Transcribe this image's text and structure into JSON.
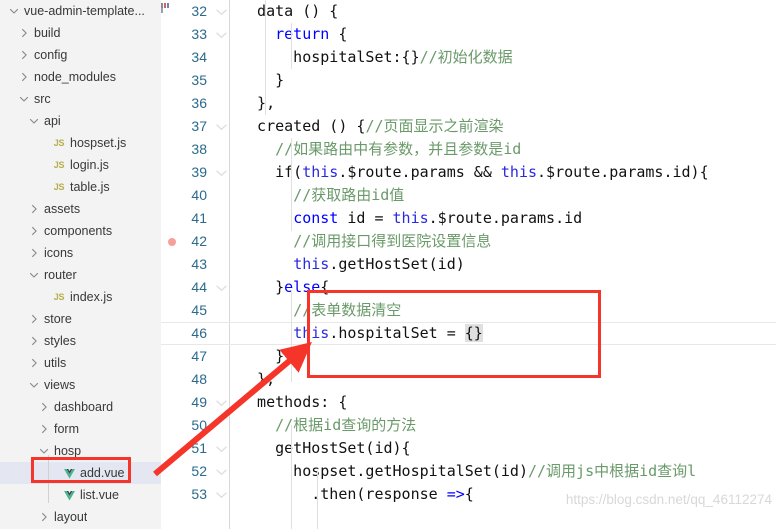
{
  "explorer": {
    "items": [
      {
        "label": "vue-admin-template...",
        "depth": 0,
        "kind": "folder",
        "state": "expanded",
        "icon": "chevron-down-icon"
      },
      {
        "label": "build",
        "depth": 1,
        "kind": "folder",
        "state": "collapsed",
        "icon": "chevron-right-icon"
      },
      {
        "label": "config",
        "depth": 1,
        "kind": "folder",
        "state": "collapsed",
        "icon": "chevron-right-icon"
      },
      {
        "label": "node_modules",
        "depth": 1,
        "kind": "folder",
        "state": "collapsed",
        "icon": "chevron-right-icon"
      },
      {
        "label": "src",
        "depth": 1,
        "kind": "folder",
        "state": "expanded",
        "icon": "chevron-down-icon"
      },
      {
        "label": "api",
        "depth": 2,
        "kind": "folder",
        "state": "expanded",
        "icon": "chevron-down-icon"
      },
      {
        "label": "hospset.js",
        "depth": 3,
        "kind": "file",
        "icon": "js-file-icon"
      },
      {
        "label": "login.js",
        "depth": 3,
        "kind": "file",
        "icon": "js-file-icon"
      },
      {
        "label": "table.js",
        "depth": 3,
        "kind": "file",
        "icon": "js-file-icon"
      },
      {
        "label": "assets",
        "depth": 2,
        "kind": "folder",
        "state": "collapsed",
        "icon": "chevron-right-icon"
      },
      {
        "label": "components",
        "depth": 2,
        "kind": "folder",
        "state": "collapsed",
        "icon": "chevron-right-icon"
      },
      {
        "label": "icons",
        "depth": 2,
        "kind": "folder",
        "state": "collapsed",
        "icon": "chevron-right-icon"
      },
      {
        "label": "router",
        "depth": 2,
        "kind": "folder",
        "state": "expanded",
        "icon": "chevron-down-icon"
      },
      {
        "label": "index.js",
        "depth": 3,
        "kind": "file",
        "icon": "js-file-icon"
      },
      {
        "label": "store",
        "depth": 2,
        "kind": "folder",
        "state": "collapsed",
        "icon": "chevron-right-icon"
      },
      {
        "label": "styles",
        "depth": 2,
        "kind": "folder",
        "state": "collapsed",
        "icon": "chevron-right-icon"
      },
      {
        "label": "utils",
        "depth": 2,
        "kind": "folder",
        "state": "collapsed",
        "icon": "chevron-right-icon"
      },
      {
        "label": "views",
        "depth": 2,
        "kind": "folder",
        "state": "expanded",
        "icon": "chevron-down-icon"
      },
      {
        "label": "dashboard",
        "depth": 3,
        "kind": "folder",
        "state": "collapsed",
        "icon": "chevron-right-icon"
      },
      {
        "label": "form",
        "depth": 3,
        "kind": "folder",
        "state": "collapsed",
        "icon": "chevron-right-icon"
      },
      {
        "label": "hosp",
        "depth": 3,
        "kind": "folder",
        "state": "expanded",
        "icon": "chevron-down-icon"
      },
      {
        "label": "add.vue",
        "depth": 4,
        "kind": "file",
        "icon": "vue-file-icon",
        "selected": true
      },
      {
        "label": "list.vue",
        "depth": 4,
        "kind": "file",
        "icon": "vue-file-icon"
      },
      {
        "label": "layout",
        "depth": 3,
        "kind": "folder",
        "state": "collapsed",
        "icon": "chevron-right-icon"
      }
    ]
  },
  "editor": {
    "first_line_number": 32,
    "active_line_number": 46,
    "breakpoint_line_number": 42,
    "fold_lines": [
      32,
      33,
      37,
      39,
      44,
      49,
      51,
      52,
      53
    ],
    "lines": [
      {
        "n": 32,
        "tokens": [
          {
            "t": "plain",
            "s": "  data () {"
          }
        ]
      },
      {
        "n": 33,
        "tokens": [
          {
            "t": "plain",
            "s": "    "
          },
          {
            "t": "kw",
            "s": "return"
          },
          {
            "t": "plain",
            "s": " {"
          }
        ]
      },
      {
        "n": 34,
        "tokens": [
          {
            "t": "plain",
            "s": "      hospitalSet:{}"
          },
          {
            "t": "cmt",
            "s": "//初始化数据"
          }
        ]
      },
      {
        "n": 35,
        "tokens": [
          {
            "t": "plain",
            "s": "    }"
          }
        ]
      },
      {
        "n": 36,
        "tokens": [
          {
            "t": "plain",
            "s": "  },"
          }
        ]
      },
      {
        "n": 37,
        "tokens": [
          {
            "t": "plain",
            "s": "  created () {"
          },
          {
            "t": "cmt",
            "s": "//页面显示之前渲染"
          }
        ]
      },
      {
        "n": 38,
        "tokens": [
          {
            "t": "plain",
            "s": "    "
          },
          {
            "t": "cmt",
            "s": "//如果路由中有参数，并且参数是id"
          }
        ]
      },
      {
        "n": 39,
        "tokens": [
          {
            "t": "plain",
            "s": "    if("
          },
          {
            "t": "this",
            "s": "this"
          },
          {
            "t": "plain",
            "s": ".$route.params && "
          },
          {
            "t": "this",
            "s": "this"
          },
          {
            "t": "plain",
            "s": ".$route.params.id){"
          }
        ]
      },
      {
        "n": 40,
        "tokens": [
          {
            "t": "plain",
            "s": "      "
          },
          {
            "t": "cmt",
            "s": "//获取路由id值"
          }
        ]
      },
      {
        "n": 41,
        "tokens": [
          {
            "t": "plain",
            "s": "      "
          },
          {
            "t": "kw",
            "s": "const"
          },
          {
            "t": "plain",
            "s": " id = "
          },
          {
            "t": "this",
            "s": "this"
          },
          {
            "t": "plain",
            "s": ".$route.params.id"
          }
        ]
      },
      {
        "n": 42,
        "tokens": [
          {
            "t": "plain",
            "s": "      "
          },
          {
            "t": "cmt",
            "s": "//调用接口得到医院设置信息"
          }
        ]
      },
      {
        "n": 43,
        "tokens": [
          {
            "t": "plain",
            "s": "      "
          },
          {
            "t": "this",
            "s": "this"
          },
          {
            "t": "plain",
            "s": ".getHostSet(id)"
          }
        ]
      },
      {
        "n": 44,
        "tokens": [
          {
            "t": "plain",
            "s": "    }"
          },
          {
            "t": "kw",
            "s": "else"
          },
          {
            "t": "plain",
            "s": "{"
          }
        ]
      },
      {
        "n": 45,
        "tokens": [
          {
            "t": "plain",
            "s": "      "
          },
          {
            "t": "cmt",
            "s": "//表单数据清空"
          }
        ]
      },
      {
        "n": 46,
        "tokens": [
          {
            "t": "plain",
            "s": "      "
          },
          {
            "t": "this",
            "s": "this"
          },
          {
            "t": "plain",
            "s": ".hospitalSet = "
          },
          {
            "t": "bracket",
            "s": "{}"
          }
        ]
      },
      {
        "n": 47,
        "tokens": [
          {
            "t": "plain",
            "s": "    }"
          }
        ]
      },
      {
        "n": 48,
        "tokens": [
          {
            "t": "plain",
            "s": "  },"
          }
        ]
      },
      {
        "n": 49,
        "tokens": [
          {
            "t": "plain",
            "s": "  methods: {"
          }
        ]
      },
      {
        "n": 50,
        "tokens": [
          {
            "t": "plain",
            "s": "    "
          },
          {
            "t": "cmt",
            "s": "//根据id查询的方法"
          }
        ]
      },
      {
        "n": 51,
        "tokens": [
          {
            "t": "plain",
            "s": "    getHostSet(id){"
          }
        ]
      },
      {
        "n": 52,
        "tokens": [
          {
            "t": "plain",
            "s": "      hospset.getHospitalSet(id)"
          },
          {
            "t": "cmt",
            "s": "//调用js中根据id查询l"
          }
        ]
      },
      {
        "n": 53,
        "tokens": [
          {
            "t": "plain",
            "s": "        .then(response "
          },
          {
            "t": "kw",
            "s": "=>"
          },
          {
            "t": "plain",
            "s": "{"
          }
        ]
      }
    ]
  },
  "annotations": {
    "code_redbox_label": "else-branch-highlight",
    "file_redbox_label": "add-vue-highlight",
    "arrow_label": "pointer-arrow"
  },
  "watermark": {
    "text": "https://blog.csdn.net/qq_46112274"
  },
  "colors": {
    "annotation_red": "#f5342a",
    "keyword_blue": "#0000ff",
    "comment_green": "#6a9a6a",
    "line_number": "#2b6a8c",
    "selection": "#e4e6f1",
    "sidebar_bg": "#f3f3f3"
  }
}
